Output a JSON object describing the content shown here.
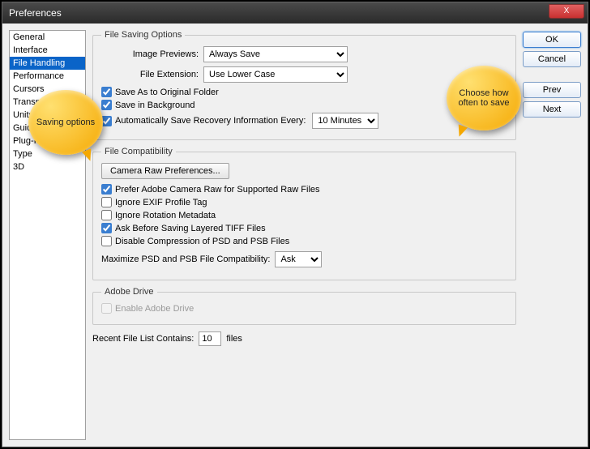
{
  "window": {
    "title": "Preferences",
    "close_x": "X"
  },
  "sidebar": {
    "items": [
      {
        "label": "General"
      },
      {
        "label": "Interface"
      },
      {
        "label": "File Handling"
      },
      {
        "label": "Performance"
      },
      {
        "label": "Cursors"
      },
      {
        "label": "Transparency & Gamut"
      },
      {
        "label": "Units & Rulers"
      },
      {
        "label": "Guides, Grid & Slices"
      },
      {
        "label": "Plug-Ins"
      },
      {
        "label": "Type"
      },
      {
        "label": "3D"
      }
    ],
    "selected_index": 2
  },
  "buttons": {
    "ok": "OK",
    "cancel": "Cancel",
    "prev": "Prev",
    "next": "Next"
  },
  "saving": {
    "legend": "File Saving Options",
    "image_previews_label": "Image Previews:",
    "image_previews_value": "Always Save",
    "file_extension_label": "File Extension:",
    "file_extension_value": "Use Lower Case",
    "save_original": "Save As to Original Folder",
    "save_background": "Save in Background",
    "auto_recovery": "Automatically Save Recovery Information Every:",
    "auto_recovery_value": "10 Minutes"
  },
  "compat": {
    "legend": "File Compatibility",
    "camera_raw_btn": "Camera Raw Preferences...",
    "prefer_acr": "Prefer Adobe Camera Raw for Supported Raw Files",
    "ignore_exif": "Ignore EXIF Profile Tag",
    "ignore_rotation": "Ignore Rotation Metadata",
    "ask_tiff": "Ask Before Saving Layered TIFF Files",
    "disable_psd": "Disable Compression of PSD and PSB Files",
    "maximize_label": "Maximize PSD and PSB File Compatibility:",
    "maximize_value": "Ask"
  },
  "drive": {
    "legend": "Adobe Drive",
    "enable": "Enable Adobe Drive"
  },
  "recent": {
    "label_pre": "Recent File List Contains:",
    "value": "10",
    "label_post": "files"
  },
  "callouts": {
    "left": "Saving options",
    "right": "Choose how often to save"
  }
}
